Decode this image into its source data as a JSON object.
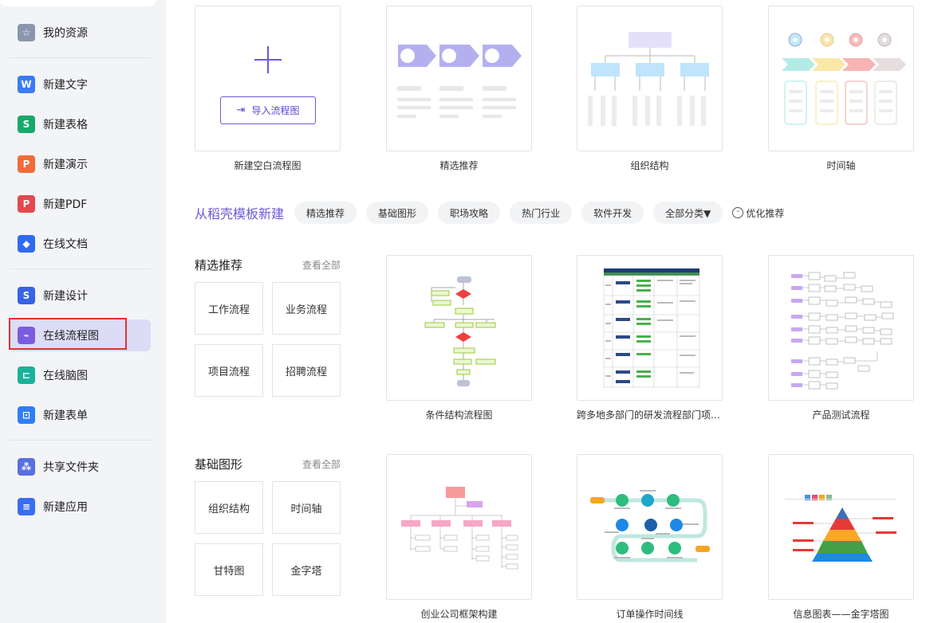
{
  "sidebar": {
    "items": [
      {
        "label": "我的资源",
        "icon": "star-icon",
        "glyph": "☆",
        "color": "#8b96ad"
      },
      {
        "label": "新建文字",
        "icon": "word-doc-icon",
        "glyph": "W",
        "color": "#3b7cf5"
      },
      {
        "label": "新建表格",
        "icon": "spreadsheet-icon",
        "glyph": "S",
        "color": "#17a96a"
      },
      {
        "label": "新建演示",
        "icon": "presentation-icon",
        "glyph": "P",
        "color": "#f26b3a"
      },
      {
        "label": "新建PDF",
        "icon": "pdf-icon",
        "glyph": "P",
        "color": "#e5484d"
      },
      {
        "label": "在线文档",
        "icon": "cloud-doc-icon",
        "glyph": "◆",
        "color": "#2f6bf2"
      },
      {
        "label": "新建设计",
        "icon": "design-icon",
        "glyph": "S",
        "color": "#3763e8"
      },
      {
        "label": "在线流程图",
        "icon": "flowchart-icon",
        "glyph": "⌁",
        "color": "#7b5ce0"
      },
      {
        "label": "在线脑图",
        "icon": "mindmap-icon",
        "glyph": "⊏",
        "color": "#19b29b"
      },
      {
        "label": "新建表单",
        "icon": "form-icon",
        "glyph": "⊡",
        "color": "#2f7df5"
      },
      {
        "label": "共享文件夹",
        "icon": "share-folder-icon",
        "glyph": "⁂",
        "color": "#5a6fe0"
      },
      {
        "label": "新建应用",
        "icon": "app-icon",
        "glyph": "≡",
        "color": "#3a6ef2"
      }
    ],
    "active_index": 7
  },
  "top_cards": {
    "blank": {
      "caption": "新建空白流程图",
      "import_label": "导入流程图"
    },
    "featured": {
      "caption": "精选推荐"
    },
    "org": {
      "caption": "组织结构"
    },
    "timeline": {
      "caption": "时间轴"
    }
  },
  "template_bar": {
    "title": "从稻壳模板新建",
    "chips": [
      "精选推荐",
      "基础图形",
      "职场攻略",
      "热门行业",
      "软件开发",
      "全部分类▼"
    ],
    "optimize_label": "优化推荐"
  },
  "sections": [
    {
      "title": "精选推荐",
      "view_all": "查看全部",
      "tiles": [
        "工作流程",
        "业务流程",
        "项目流程",
        "招聘流程"
      ],
      "templates": [
        "条件结构流程图",
        "跨多地多部门的研发流程部门项目管理",
        "产品测试流程"
      ]
    },
    {
      "title": "基础图形",
      "view_all": "查看全部",
      "tiles": [
        "组织结构",
        "时间轴",
        "甘特图",
        "金字塔"
      ],
      "templates": [
        "创业公司框架构建",
        "订单操作时间线",
        "信息图表——金字塔图"
      ]
    }
  ],
  "colors": {
    "accent": "#6a5ad6",
    "active_bg": "#dcdcf7",
    "highlight": "#e03131"
  }
}
